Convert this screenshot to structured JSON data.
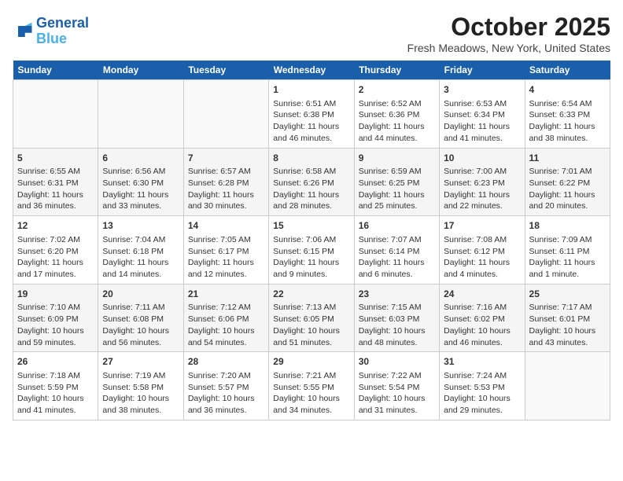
{
  "header": {
    "logo_line1": "General",
    "logo_line2": "Blue",
    "month_year": "October 2025",
    "location": "Fresh Meadows, New York, United States"
  },
  "weekdays": [
    "Sunday",
    "Monday",
    "Tuesday",
    "Wednesday",
    "Thursday",
    "Friday",
    "Saturday"
  ],
  "weeks": [
    [
      {
        "day": "",
        "info": ""
      },
      {
        "day": "",
        "info": ""
      },
      {
        "day": "",
        "info": ""
      },
      {
        "day": "1",
        "info": "Sunrise: 6:51 AM\nSunset: 6:38 PM\nDaylight: 11 hours and 46 minutes."
      },
      {
        "day": "2",
        "info": "Sunrise: 6:52 AM\nSunset: 6:36 PM\nDaylight: 11 hours and 44 minutes."
      },
      {
        "day": "3",
        "info": "Sunrise: 6:53 AM\nSunset: 6:34 PM\nDaylight: 11 hours and 41 minutes."
      },
      {
        "day": "4",
        "info": "Sunrise: 6:54 AM\nSunset: 6:33 PM\nDaylight: 11 hours and 38 minutes."
      }
    ],
    [
      {
        "day": "5",
        "info": "Sunrise: 6:55 AM\nSunset: 6:31 PM\nDaylight: 11 hours and 36 minutes."
      },
      {
        "day": "6",
        "info": "Sunrise: 6:56 AM\nSunset: 6:30 PM\nDaylight: 11 hours and 33 minutes."
      },
      {
        "day": "7",
        "info": "Sunrise: 6:57 AM\nSunset: 6:28 PM\nDaylight: 11 hours and 30 minutes."
      },
      {
        "day": "8",
        "info": "Sunrise: 6:58 AM\nSunset: 6:26 PM\nDaylight: 11 hours and 28 minutes."
      },
      {
        "day": "9",
        "info": "Sunrise: 6:59 AM\nSunset: 6:25 PM\nDaylight: 11 hours and 25 minutes."
      },
      {
        "day": "10",
        "info": "Sunrise: 7:00 AM\nSunset: 6:23 PM\nDaylight: 11 hours and 22 minutes."
      },
      {
        "day": "11",
        "info": "Sunrise: 7:01 AM\nSunset: 6:22 PM\nDaylight: 11 hours and 20 minutes."
      }
    ],
    [
      {
        "day": "12",
        "info": "Sunrise: 7:02 AM\nSunset: 6:20 PM\nDaylight: 11 hours and 17 minutes."
      },
      {
        "day": "13",
        "info": "Sunrise: 7:04 AM\nSunset: 6:18 PM\nDaylight: 11 hours and 14 minutes."
      },
      {
        "day": "14",
        "info": "Sunrise: 7:05 AM\nSunset: 6:17 PM\nDaylight: 11 hours and 12 minutes."
      },
      {
        "day": "15",
        "info": "Sunrise: 7:06 AM\nSunset: 6:15 PM\nDaylight: 11 hours and 9 minutes."
      },
      {
        "day": "16",
        "info": "Sunrise: 7:07 AM\nSunset: 6:14 PM\nDaylight: 11 hours and 6 minutes."
      },
      {
        "day": "17",
        "info": "Sunrise: 7:08 AM\nSunset: 6:12 PM\nDaylight: 11 hours and 4 minutes."
      },
      {
        "day": "18",
        "info": "Sunrise: 7:09 AM\nSunset: 6:11 PM\nDaylight: 11 hours and 1 minute."
      }
    ],
    [
      {
        "day": "19",
        "info": "Sunrise: 7:10 AM\nSunset: 6:09 PM\nDaylight: 10 hours and 59 minutes."
      },
      {
        "day": "20",
        "info": "Sunrise: 7:11 AM\nSunset: 6:08 PM\nDaylight: 10 hours and 56 minutes."
      },
      {
        "day": "21",
        "info": "Sunrise: 7:12 AM\nSunset: 6:06 PM\nDaylight: 10 hours and 54 minutes."
      },
      {
        "day": "22",
        "info": "Sunrise: 7:13 AM\nSunset: 6:05 PM\nDaylight: 10 hours and 51 minutes."
      },
      {
        "day": "23",
        "info": "Sunrise: 7:15 AM\nSunset: 6:03 PM\nDaylight: 10 hours and 48 minutes."
      },
      {
        "day": "24",
        "info": "Sunrise: 7:16 AM\nSunset: 6:02 PM\nDaylight: 10 hours and 46 minutes."
      },
      {
        "day": "25",
        "info": "Sunrise: 7:17 AM\nSunset: 6:01 PM\nDaylight: 10 hours and 43 minutes."
      }
    ],
    [
      {
        "day": "26",
        "info": "Sunrise: 7:18 AM\nSunset: 5:59 PM\nDaylight: 10 hours and 41 minutes."
      },
      {
        "day": "27",
        "info": "Sunrise: 7:19 AM\nSunset: 5:58 PM\nDaylight: 10 hours and 38 minutes."
      },
      {
        "day": "28",
        "info": "Sunrise: 7:20 AM\nSunset: 5:57 PM\nDaylight: 10 hours and 36 minutes."
      },
      {
        "day": "29",
        "info": "Sunrise: 7:21 AM\nSunset: 5:55 PM\nDaylight: 10 hours and 34 minutes."
      },
      {
        "day": "30",
        "info": "Sunrise: 7:22 AM\nSunset: 5:54 PM\nDaylight: 10 hours and 31 minutes."
      },
      {
        "day": "31",
        "info": "Sunrise: 7:24 AM\nSunset: 5:53 PM\nDaylight: 10 hours and 29 minutes."
      },
      {
        "day": "",
        "info": ""
      }
    ]
  ]
}
